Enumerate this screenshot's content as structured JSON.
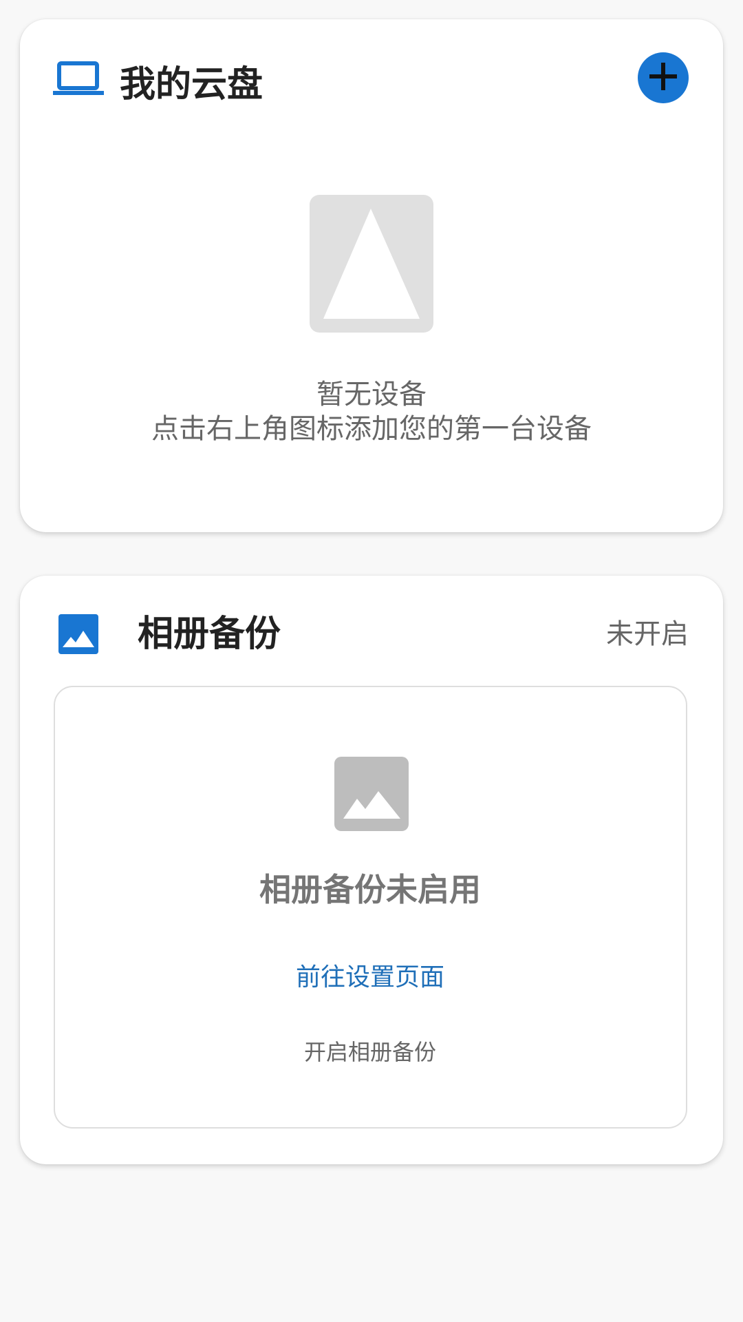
{
  "cloud_card": {
    "title": "我的云盘",
    "title_icon": "laptop-icon",
    "add_icon": "plus-icon",
    "empty_title": "暂无设备",
    "empty_hint": "点击右上角图标添加您的第一台设备",
    "placeholder_icon": "image-placeholder-icon"
  },
  "album_card": {
    "title": "相册备份",
    "title_icon": "photo-icon",
    "status": "未开启",
    "inner": {
      "icon": "photo-icon",
      "title": "相册备份未启用",
      "link": "前往设置页面",
      "hint": "开启相册备份"
    }
  },
  "colors": {
    "accent": "#1976d2",
    "link": "#1f6fb8",
    "background": "#f8f8f8",
    "card": "#ffffff",
    "muted_text": "#666666",
    "placeholder": "#e0e0e0",
    "inner_icon": "#bdbdbd"
  }
}
